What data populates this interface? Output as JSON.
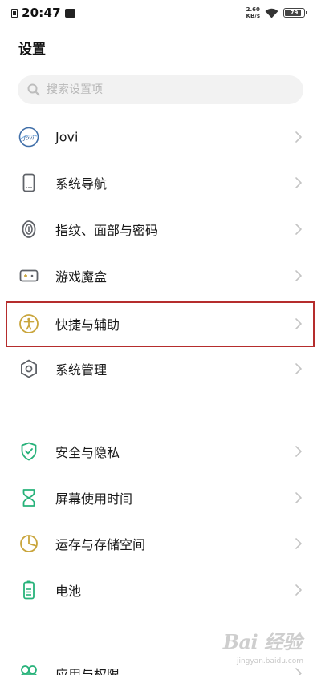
{
  "status_bar": {
    "time": "20:47",
    "net_speed_value": "2.60",
    "net_speed_unit": "KB/s",
    "battery": "79"
  },
  "page": {
    "title": "设置"
  },
  "search": {
    "placeholder": "搜索设置项"
  },
  "items": [
    {
      "label": "Jovi",
      "icon": "jovi-icon"
    },
    {
      "label": "系统导航",
      "icon": "phone-navigation-icon"
    },
    {
      "label": "指纹、面部与密码",
      "icon": "fingerprint-icon"
    },
    {
      "label": "游戏魔盒",
      "icon": "game-box-icon"
    },
    {
      "label": "快捷与辅助",
      "icon": "accessibility-icon"
    },
    {
      "label": "系统管理",
      "icon": "system-settings-icon"
    },
    {
      "label": "安全与隐私",
      "icon": "shield-check-icon"
    },
    {
      "label": "屏幕使用时间",
      "icon": "hourglass-icon"
    },
    {
      "label": "运存与存储空间",
      "icon": "storage-pie-icon"
    },
    {
      "label": "电池",
      "icon": "battery-icon"
    },
    {
      "label": "应用与权限",
      "icon": "apps-permissions-icon"
    }
  ],
  "watermark": {
    "brand": "Bai 经验",
    "sub": "jingyan.baidu.com"
  },
  "colors": {
    "highlight_box": "#b52d2d",
    "icon_gray": "#5f6268",
    "icon_green": "#27b27a",
    "icon_gold": "#c9a53c"
  }
}
